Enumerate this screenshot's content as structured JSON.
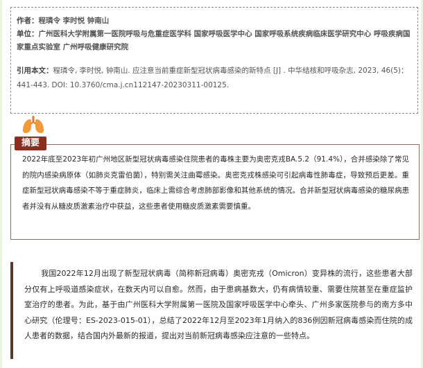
{
  "authors": {
    "label": "作者：",
    "value": "程璘令  李时悦  钟南山"
  },
  "affiliation": {
    "label": "单位：",
    "value": "广州医科大学附属第一医院呼吸与危重症医学科  国家呼吸医学中心  国家呼吸系统疾病临床医学研究中心  呼吸疾病国家重点实验室  广州呼吸健康研究院"
  },
  "citation": {
    "label": "引用本文：",
    "value": "程璘令, 李时悦, 钟南山. 应注意当前重症新型冠状病毒感染的新特点 [J] . 中华结核和呼吸杂志, 2023, 46(5)：441-443. DOI: 10.3760/cma.j.cn112147-20230311-00125."
  },
  "lungs_icon": "lungs-icon",
  "abstract": {
    "tag": "摘要",
    "text": "2022年底至2023年初广州地区新型冠状病毒感染住院患者的毒株主要为奥密克戎BA.5.2（91.4%），合并感染除了常见的院内感染病原体（如肺炎克雷伯菌），特别需关注曲霉感染。奥密克戎株感染可引起病毒性肺毒症，导致预后更差。重症新型冠状病毒感染不等于重症肺炎，临床上需综合考虑肺部影像和其他系统的情况。合并新型冠状病毒感染的糖尿病患者并没有从糖皮质激素治疗中获益，这些患者使用糖皮质激素需要慎重。"
  },
  "body": {
    "text": "我国2022年12月出现了新型冠状病毒（简称新冠病毒）奥密克戎（Omicron）变异株的流行，这些患者大部分仅有上呼吸道感染症状，在数天内可以自愈。然而，由于患病基数大，仍有病情较重、需要住院甚至在重症监护室治疗的患者。为此，基于由广州医科大学附属第一医院及国家呼吸医学中心牵头、广州多家医院参与的南方多中心研究（伦理号：ES-2023-015-01），总结了2022年12月至2023年1月纳入的836例因新冠病毒感染而住院的成人患者的数据，结合国内外最新的报道，提出对当前新冠病毒感染应注意的一些特点。"
  },
  "colors": {
    "page_bg": "#e9f4e3",
    "tag_bg": "#8b2e1e",
    "box_border": "#8b6b5a",
    "body_rule": "#5a3a2e"
  }
}
